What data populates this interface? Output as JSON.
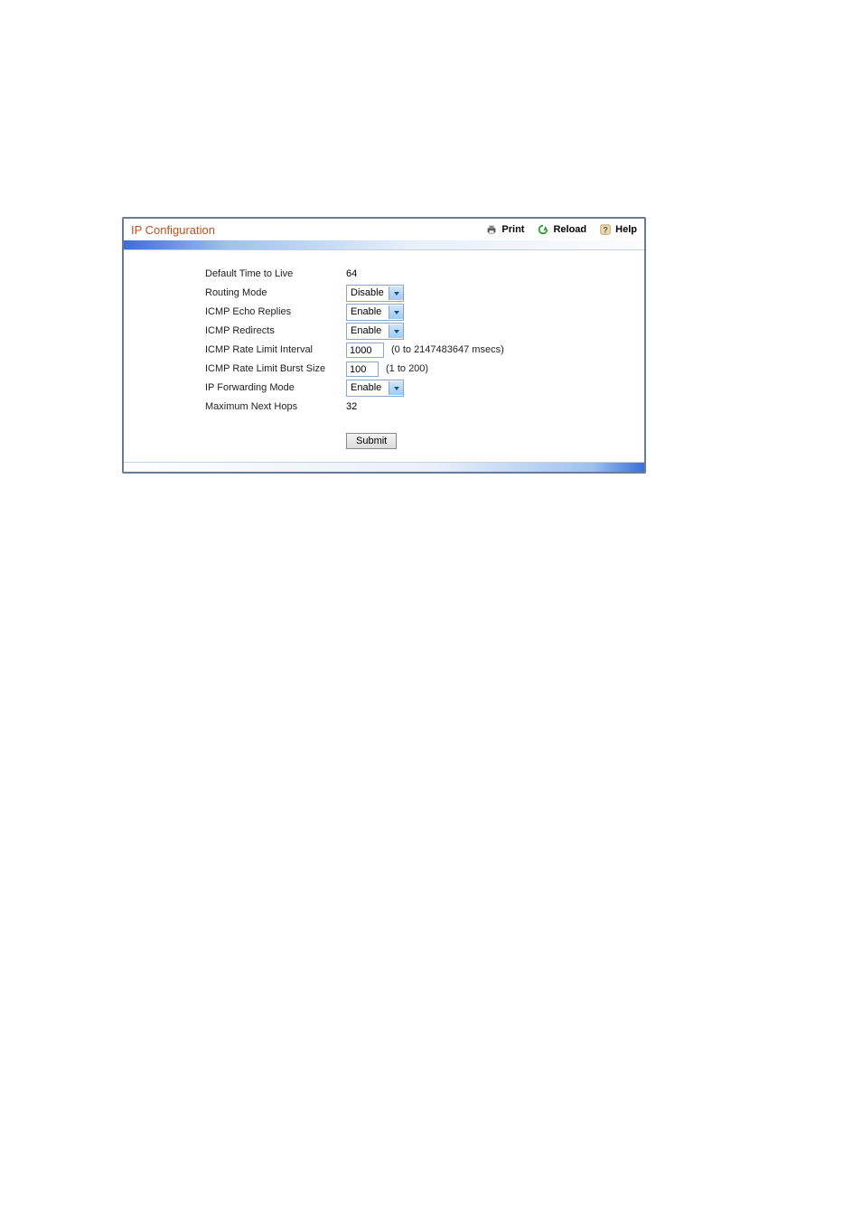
{
  "header": {
    "title": "IP Configuration",
    "print": "Print",
    "reload": "Reload",
    "help": "Help"
  },
  "rows": {
    "ttl": {
      "label": "Default Time to Live",
      "value": "64"
    },
    "routing": {
      "label": "Routing Mode",
      "value": "Disable"
    },
    "echo": {
      "label": "ICMP Echo Replies",
      "value": "Enable"
    },
    "redir": {
      "label": "ICMP Redirects",
      "value": "Enable"
    },
    "rlint": {
      "label": "ICMP Rate Limit Interval",
      "value": "1000",
      "hint": "(0 to 2147483647 msecs)"
    },
    "rlburst": {
      "label": "ICMP Rate Limit Burst Size",
      "value": "100",
      "hint": "(1 to 200)"
    },
    "fwd": {
      "label": "IP Forwarding Mode",
      "value": "Enable"
    },
    "hops": {
      "label": "Maximum Next Hops",
      "value": "32"
    }
  },
  "buttons": {
    "submit": "Submit"
  }
}
